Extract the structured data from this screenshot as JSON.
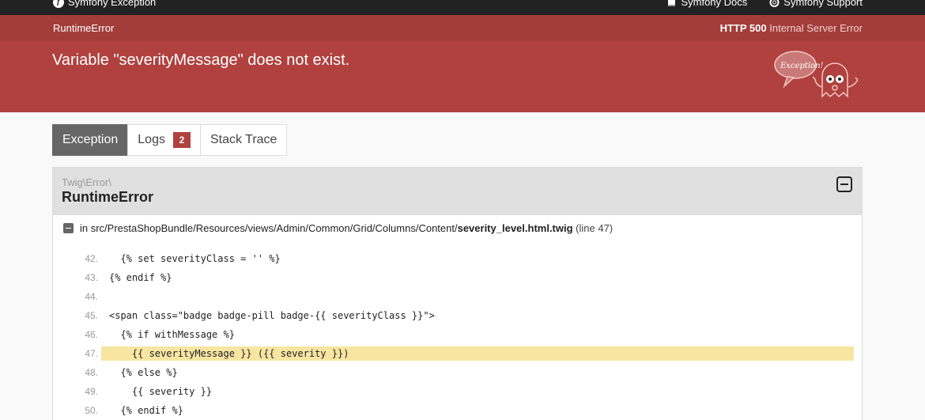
{
  "topbar": {
    "brand": "Symfony Exception",
    "docs": "Symfony Docs",
    "support": "Symfony Support"
  },
  "summary": {
    "exception_class": "RuntimeError",
    "http_code": "HTTP 500",
    "http_text": "Internal Server Error",
    "message": "Variable \"severityMessage\" does not exist.",
    "ghost_label": "Exception!"
  },
  "tabs": [
    {
      "label": "Exception"
    },
    {
      "label": "Logs",
      "count": "2"
    },
    {
      "label": "Stack Trace"
    }
  ],
  "exception": {
    "namespace": "Twig\\Error\\",
    "class": "RuntimeError",
    "file_prefix": "in src/PrestaShopBundle/Resources/views/Admin/Common/Grid/Columns/Content/",
    "file_name": "severity_level.html.twig",
    "line_info": "(line 47)",
    "code": [
      {
        "num": "42.",
        "text": "  {% set severityClass = '' %}"
      },
      {
        "num": "43.",
        "text": "{% endif %}"
      },
      {
        "num": "44.",
        "text": ""
      },
      {
        "num": "45.",
        "text": "<span class=\"badge badge-pill badge-{{ severityClass }}\">"
      },
      {
        "num": "46.",
        "text": "  {% if withMessage %}"
      },
      {
        "num": "47.",
        "text": "    {{ severityMessage }} ({{ severity }})",
        "highlight": true
      },
      {
        "num": "48.",
        "text": "  {% else %}"
      },
      {
        "num": "49.",
        "text": "    {{ severity }}"
      },
      {
        "num": "50.",
        "text": "  {% endif %}"
      }
    ]
  }
}
